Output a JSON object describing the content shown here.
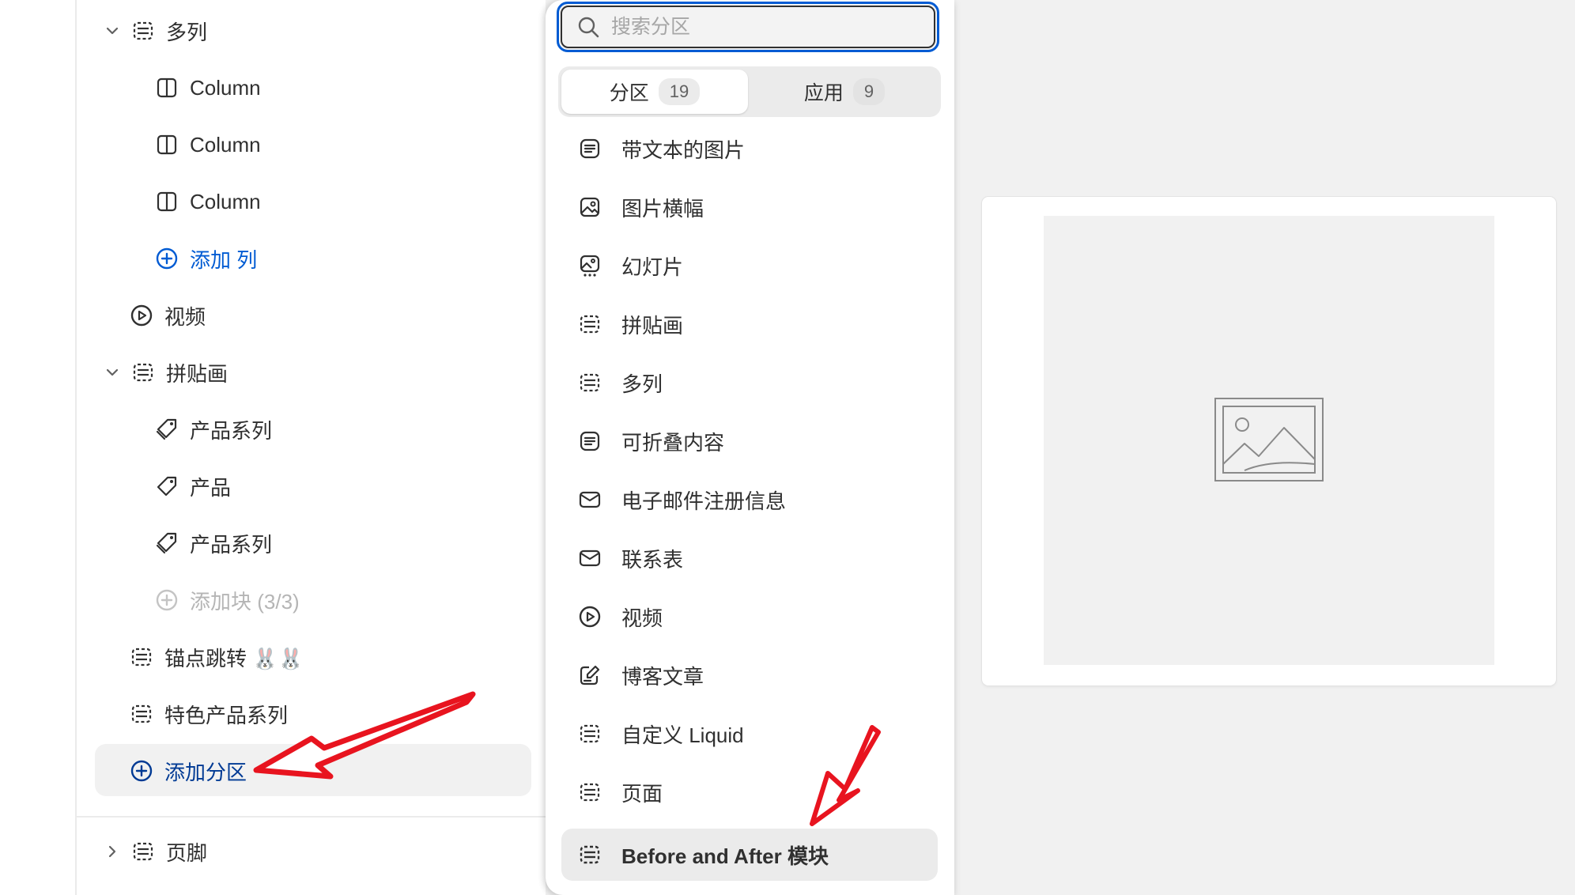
{
  "sidebar": {
    "items": [
      {
        "label": "多列",
        "icon": "section-icon",
        "expanded": true
      },
      {
        "label": "Column",
        "icon": "column-icon"
      },
      {
        "label": "Column",
        "icon": "column-icon"
      },
      {
        "label": "Column",
        "icon": "column-icon"
      },
      {
        "label": "添加 列",
        "icon": "plus-circle-icon"
      },
      {
        "label": "视频",
        "icon": "play-circle-icon"
      },
      {
        "label": "拼贴画",
        "icon": "section-icon",
        "expanded": true
      },
      {
        "label": "产品系列",
        "icon": "tags-icon"
      },
      {
        "label": "产品",
        "icon": "tag-icon"
      },
      {
        "label": "产品系列",
        "icon": "tags-icon"
      },
      {
        "label": "添加块 (3/3)",
        "icon": "plus-circle-icon",
        "disabled": true
      },
      {
        "label": "锚点跳转 🐰🐰",
        "icon": "section-icon"
      },
      {
        "label": "特色产品系列",
        "icon": "section-icon"
      },
      {
        "label": "添加分区",
        "icon": "plus-circle-icon"
      },
      {
        "label": "页脚",
        "icon": "section-icon",
        "expanded": false
      }
    ]
  },
  "picker": {
    "search_placeholder": "搜索分区",
    "tabs": [
      {
        "label": "分区",
        "count": "19",
        "active": true
      },
      {
        "label": "应用",
        "count": "9",
        "active": false
      }
    ],
    "items": [
      {
        "label": "带文本的图片",
        "icon": "text-block-icon"
      },
      {
        "label": "图片横幅",
        "icon": "image-icon"
      },
      {
        "label": "幻灯片",
        "icon": "slideshow-icon"
      },
      {
        "label": "拼贴画",
        "icon": "section-icon"
      },
      {
        "label": "多列",
        "icon": "section-icon"
      },
      {
        "label": "可折叠内容",
        "icon": "text-block-icon"
      },
      {
        "label": "电子邮件注册信息",
        "icon": "email-icon"
      },
      {
        "label": "联系表",
        "icon": "email-icon"
      },
      {
        "label": "视频",
        "icon": "play-circle-icon"
      },
      {
        "label": "博客文章",
        "icon": "edit-document-icon"
      },
      {
        "label": "自定义 Liquid",
        "icon": "section-icon"
      },
      {
        "label": "页面",
        "icon": "section-icon"
      },
      {
        "label": "Before and After 模块",
        "icon": "section-icon",
        "hovered": true
      }
    ]
  },
  "preview": {
    "placeholder_icon": "image-placeholder-icon"
  },
  "colors": {
    "accent": "#005bd3",
    "annotation_arrow": "#e8141f",
    "text": "#303030",
    "muted": "#b5b5b5"
  }
}
